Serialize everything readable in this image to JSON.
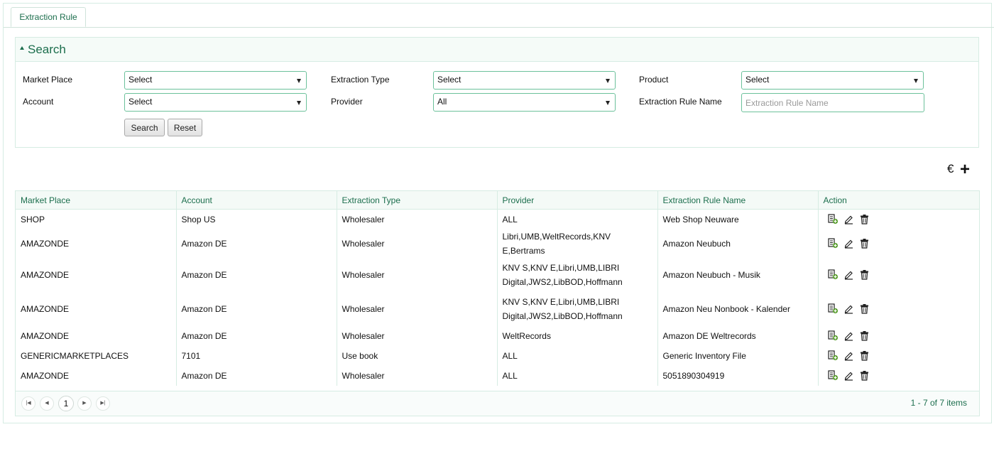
{
  "tab": {
    "label": "Extraction Rule"
  },
  "search": {
    "title": "Search",
    "market_place": {
      "label": "Market Place",
      "value": "Select"
    },
    "extraction_type": {
      "label": "Extraction Type",
      "value": "Select"
    },
    "product": {
      "label": "Product",
      "value": "Select"
    },
    "account": {
      "label": "Account",
      "value": "Select"
    },
    "provider": {
      "label": "Provider",
      "value": "All"
    },
    "rule_name": {
      "label": "Extraction Rule Name",
      "placeholder": "Extraction Rule Name",
      "value": ""
    },
    "search_button": "Search",
    "reset_button": "Reset"
  },
  "toolbar": {
    "euro_symbol": "€",
    "add_symbol": "+"
  },
  "grid": {
    "columns": [
      "Market Place",
      "Account",
      "Extraction Type",
      "Provider",
      "Extraction Rule Name",
      "Action"
    ],
    "rows": [
      {
        "market": "SHOP",
        "account": "Shop US",
        "type": "Wholesaler",
        "provider": "ALL",
        "name": "Web Shop Neuware"
      },
      {
        "market": "AMAZONDE",
        "account": "Amazon DE",
        "type": "Wholesaler",
        "provider": "Libri,UMB,WeltRecords,KNV E,Bertrams",
        "name": "Amazon Neubuch"
      },
      {
        "market": "AMAZONDE",
        "account": "Amazon DE",
        "type": "Wholesaler",
        "provider": "KNV S,KNV E,Libri,UMB,LIBRI Digital,JWS2,LibBOD,Hoffmann",
        "name": "Amazon Neubuch - Musik"
      },
      {
        "market": "AMAZONDE",
        "account": "Amazon DE",
        "type": "Wholesaler",
        "provider": "KNV S,KNV E,Libri,UMB,LIBRI Digital,JWS2,LibBOD,Hoffmann",
        "name": "Amazon Neu Nonbook - Kalender"
      },
      {
        "market": "AMAZONDE",
        "account": "Amazon DE",
        "type": "Wholesaler",
        "provider": "WeltRecords",
        "name": "Amazon DE Weltrecords"
      },
      {
        "market": "GENERICMARKETPLACES",
        "account": "7101",
        "type": "Use book",
        "provider": "ALL",
        "name": "Generic Inventory File"
      },
      {
        "market": "AMAZONDE",
        "account": "Amazon DE",
        "type": "Wholesaler",
        "provider": "ALL",
        "name": "5051890304919"
      }
    ],
    "action_icons": [
      "copy-icon",
      "edit-icon",
      "delete-icon"
    ]
  },
  "pager": {
    "current_page": "1",
    "info": "1 - 7 of 7 items"
  }
}
